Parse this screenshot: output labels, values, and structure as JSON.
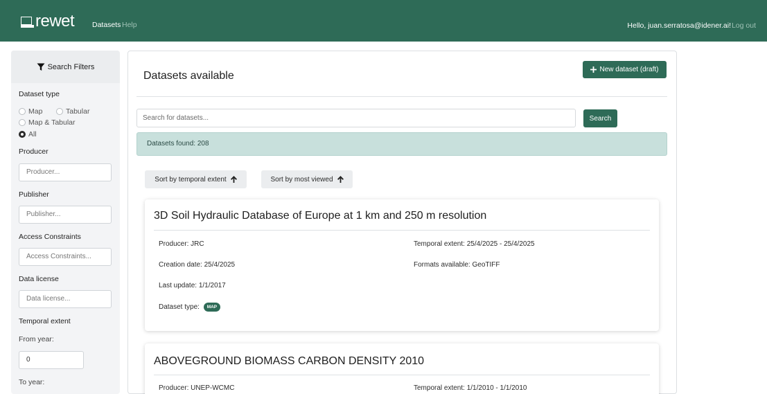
{
  "nav": {
    "logo": "rewet",
    "links": [
      "Datasets",
      "Help"
    ],
    "greeting": "Hello, juan.serratosa@idener.ai!",
    "logout": "Log out",
    "brand_color": "#2e6b57"
  },
  "sidebar": {
    "header": "Search Filters",
    "dataset_type_label": "Dataset type",
    "dataset_type_options": [
      {
        "label": "Map",
        "selected": false
      },
      {
        "label": "Tabular",
        "selected": false
      },
      {
        "label": "Map & Tabular",
        "selected": false
      },
      {
        "label": "All",
        "selected": true
      }
    ],
    "producer_label": "Producer",
    "producer_placeholder": "Producer...",
    "publisher_label": "Publisher",
    "publisher_placeholder": "Publisher...",
    "access_label": "Access Constraints",
    "access_placeholder": "Access Constraints...",
    "license_label": "Data license",
    "license_placeholder": "Data license...",
    "temporal_label": "Temporal extent",
    "from_label": "From year:",
    "from_value": "0",
    "to_label": "To year:"
  },
  "main": {
    "title": "Datasets available",
    "new_button": "New dataset (draft)",
    "search_placeholder": "Search for datasets...",
    "search_button": "Search",
    "found_text": "Datasets found: 208",
    "sort_temporal": "Sort by temporal extent",
    "sort_viewed": "Sort by most viewed"
  },
  "datasets": [
    {
      "title": "3D Soil Hydraulic Database of Europe at 1 km and 250 m resolution",
      "producer": "Producer: JRC",
      "creation": "Creation date: 25/4/2025",
      "last_update": "Last update: 1/1/2017",
      "type_label": "Dataset type:",
      "type_badge": "MAP",
      "temporal": "Temporal extent: 25/4/2025 - 25/4/2025",
      "formats": "Formats available: GeoTIFF"
    },
    {
      "title": "ABOVEGROUND BIOMASS CARBON DENSITY 2010",
      "producer": "Producer: UNEP-WCMC",
      "temporal": "Temporal extent: 1/1/2010 - 1/1/2010"
    }
  ]
}
